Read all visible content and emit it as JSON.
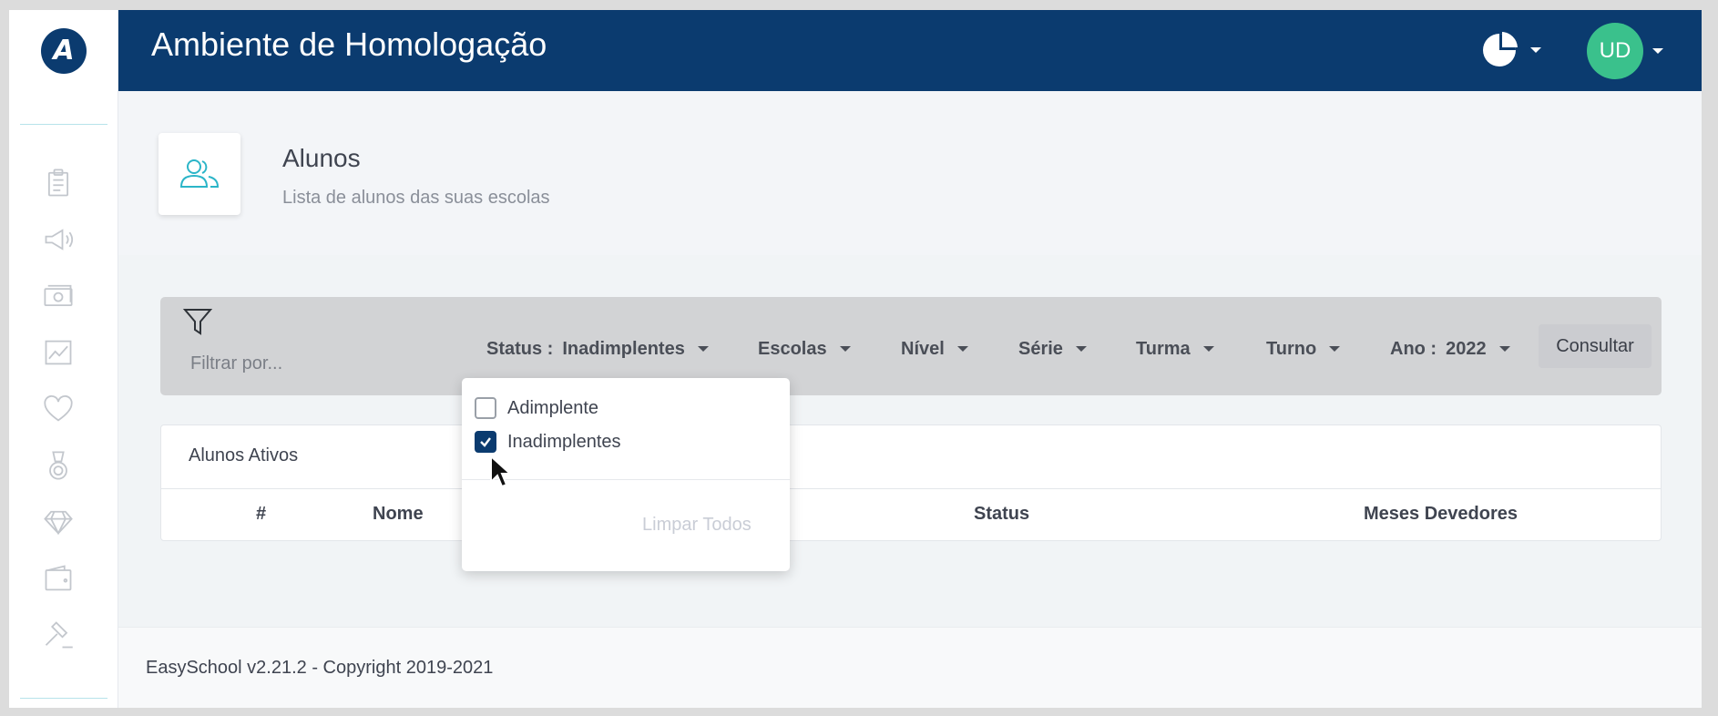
{
  "app": {
    "logo_letter": "A",
    "env_title": "Ambiente de Homologação",
    "user_initials": "UD"
  },
  "sidebar": {
    "icons": [
      "clipboard-icon",
      "megaphone-icon",
      "money-icon",
      "line-chart-icon",
      "heart-icon",
      "medal-icon",
      "diamond-icon",
      "wallet-icon",
      "gavel-icon"
    ]
  },
  "page": {
    "title": "Alunos",
    "subtitle": "Lista de alunos das suas escolas"
  },
  "filters": {
    "filter_placeholder": "Filtrar por...",
    "status_label": "Status :",
    "status_value": "Inadimplentes",
    "escolas": "Escolas",
    "nivel": "Nível",
    "serie": "Série",
    "turma": "Turma",
    "turno": "Turno",
    "ano_label": "Ano :",
    "ano_value": "2022",
    "consultar": "Consultar"
  },
  "status_menu": {
    "options": [
      {
        "label": "Adimplente",
        "checked": false
      },
      {
        "label": "Inadimplentes",
        "checked": true
      }
    ],
    "clear_all": "Limpar Todos"
  },
  "table": {
    "title": "Alunos Ativos",
    "columns": [
      "#",
      "Nome",
      "Status",
      "Meses Devedores"
    ]
  },
  "footer": {
    "text": "EasySchool v2.21.2 - Copyright 2019-2021"
  },
  "colors": {
    "primary": "#0b3b6f",
    "avatar": "#3ac18c",
    "accent": "#2bb5c8"
  }
}
